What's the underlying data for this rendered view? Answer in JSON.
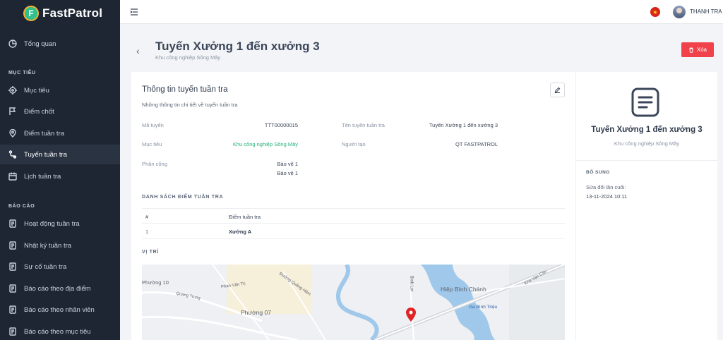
{
  "app": {
    "name": "FastPatrol",
    "logo_letter": "F",
    "brand_color": "#2fc08c"
  },
  "sidebar": {
    "overview": {
      "label": "Tổng quan",
      "icon": "pie-chart-icon"
    },
    "section_targets": "MỤC TIÊU",
    "target_items": [
      {
        "label": "Mục tiêu",
        "icon": "crosshair-icon"
      },
      {
        "label": "Điểm chốt",
        "icon": "flag-icon"
      },
      {
        "label": "Điểm tuần tra",
        "icon": "map-pin-icon"
      },
      {
        "label": "Tuyến tuần tra",
        "icon": "route-icon",
        "active": true
      },
      {
        "label": "Lịch tuần tra",
        "icon": "calendar-icon"
      }
    ],
    "section_reports": "BÁO CÁO",
    "report_items": [
      {
        "label": "Hoạt động tuần tra",
        "icon": "report-icon"
      },
      {
        "label": "Nhật ký tuần tra",
        "icon": "report-icon"
      },
      {
        "label": "Sự cố tuần tra",
        "icon": "report-icon"
      },
      {
        "label": "Báo cáo theo địa điểm",
        "icon": "report-icon"
      },
      {
        "label": "Báo cáo theo nhân viên",
        "icon": "report-icon"
      },
      {
        "label": "Báo cáo theo mục tiêu",
        "icon": "report-icon"
      }
    ]
  },
  "topbar": {
    "username": "THANH TRA",
    "flag_star": "★"
  },
  "page": {
    "title": "Tuyến Xưởng 1 đến xưởng 3",
    "subtitle": "Khu công nghiệp Sông Mây",
    "delete_label": "Xóa"
  },
  "info": {
    "title": "Thông tin tuyến tuần tra",
    "description": "Những thông tin chi tiết về tuyến tuần tra",
    "route_code_label": "Mã tuyến",
    "route_code": "TTT00000015",
    "route_name_label": "Tên tuyến tuần tra",
    "route_name": "Tuyến Xưởng 1 đến xưởng 3",
    "target_label": "Mục tiêu",
    "target": "Khu công nghiệp Sông Mây",
    "creator_label": "Người tạo",
    "creator": "QT FASTPATROL",
    "assign_label": "Phân công",
    "assignees": [
      "Bảo vệ 1",
      "Bảo vệ 1"
    ]
  },
  "checkpoints": {
    "heading": "DANH SÁCH ĐIỂM TUẦN TRA",
    "columns": [
      "#",
      "Điểm tuần tra"
    ],
    "rows": [
      {
        "index": "1",
        "name": "Xưởng A"
      }
    ]
  },
  "location": {
    "heading": "VỊ TRÍ",
    "map_labels": [
      "Phường 10",
      "Phan Văn Trị",
      "Quang Trung",
      "Đường Quảng Hàm",
      "Phường 07",
      "Bình Lợi",
      "Hiệp Bình Chánh",
      "Ga Bình Triệu",
      "Kha Vạn Cân"
    ]
  },
  "summary": {
    "title": "Tuyến Xưởng 1 đến xưởng 3",
    "subtitle": "Khu công nghiệp Sông Mây",
    "extra_heading": "BỔ SUNG",
    "last_modified_label": "Sửa đổi lần cuối:",
    "last_modified": "13-11-2024 10:11"
  }
}
